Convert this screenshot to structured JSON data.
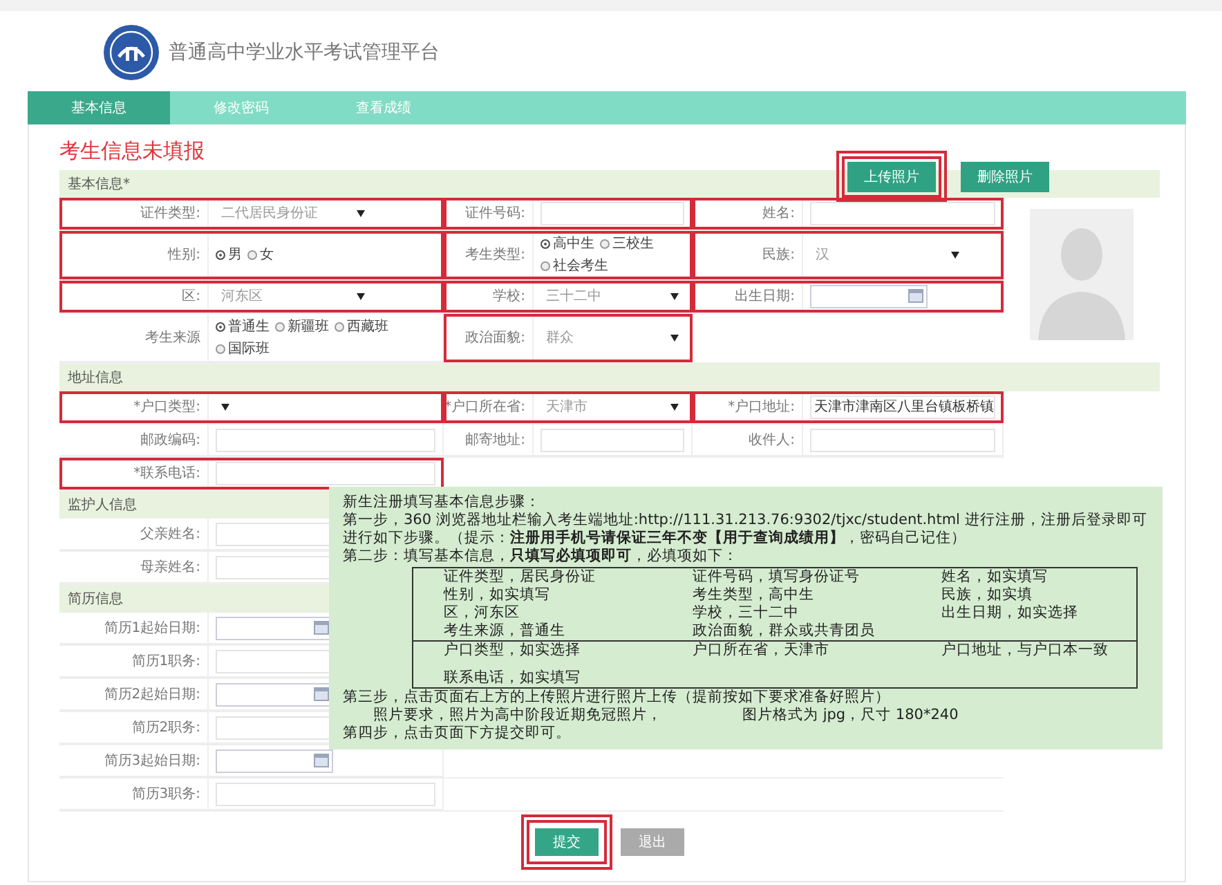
{
  "header": {
    "title": "普通高中学业水平考试管理平台"
  },
  "tabs": [
    {
      "label": "基本信息",
      "selected": true
    },
    {
      "label": "修改密码",
      "selected": false
    },
    {
      "label": "查看成绩",
      "selected": false
    }
  ],
  "form": {
    "title": "考生信息未填报",
    "sections": [
      {
        "title": "基本信息*",
        "buttons": [
          {
            "label": "上传照片",
            "highlighted": true
          },
          {
            "label": "删除照片",
            "highlighted": false
          }
        ],
        "rows": [
          {
            "fields": [
              {
                "label": "证件类型:",
                "kind": "select",
                "value": "二代居民身份证",
                "highlighted": true
              },
              {
                "label": "证件号码:",
                "kind": "input",
                "highlighted": true
              },
              {
                "label": "姓名:",
                "kind": "input",
                "highlighted": true
              }
            ]
          },
          {
            "fields": [
              {
                "label": "性别:",
                "kind": "radio",
                "highlighted": true,
                "options": [
                  {
                    "label": "男",
                    "selected": true
                  },
                  {
                    "label": "女",
                    "selected": false
                  }
                ]
              },
              {
                "label": "考生类型:",
                "kind": "radio",
                "highlighted": true,
                "options": [
                  {
                    "label": "高中生",
                    "selected": true
                  },
                  {
                    "label": "三校生",
                    "selected": false
                  },
                  {
                    "label": "社会考生",
                    "selected": false
                  }
                ]
              },
              {
                "label": "民族:",
                "kind": "select",
                "value": "汉",
                "highlighted": true
              }
            ]
          },
          {
            "fields": [
              {
                "label": "区:",
                "kind": "select",
                "value": "河东区",
                "highlighted": true
              },
              {
                "label": "学校:",
                "kind": "select",
                "value": "三十二中",
                "highlighted": true
              },
              {
                "label": "出生日期:",
                "kind": "date",
                "highlighted": true
              }
            ]
          },
          {
            "fields": [
              {
                "label": "考生来源",
                "kind": "radio",
                "highlighted": false,
                "options": [
                  {
                    "label": "普通生",
                    "selected": true
                  },
                  {
                    "label": "新疆班",
                    "selected": false
                  },
                  {
                    "label": "西藏班",
                    "selected": false
                  },
                  {
                    "label": "国际班",
                    "selected": false
                  }
                ]
              },
              {
                "label": "政治面貌:",
                "kind": "select",
                "value": "群众",
                "highlighted": true
              }
            ]
          }
        ]
      },
      {
        "title": "地址信息",
        "rows": [
          {
            "fields": [
              {
                "label": "*户口类型:",
                "kind": "select",
                "highlighted": true
              },
              {
                "label": "*户口所在省:",
                "kind": "select",
                "value": "天津市",
                "highlighted": true
              },
              {
                "label": "*户口地址:",
                "kind": "input",
                "value": "天津市津南区八里台镇板桥镇",
                "highlighted": true
              }
            ]
          },
          {
            "fields": [
              {
                "label": "邮政编码:",
                "kind": "input",
                "highlighted": false
              },
              {
                "label": "邮寄地址:",
                "kind": "input",
                "highlighted": false
              },
              {
                "label": "收件人:",
                "kind": "input",
                "highlighted": false
              }
            ]
          },
          {
            "fields": [
              {
                "label": "*联系电话:",
                "kind": "input",
                "highlighted": true
              }
            ]
          }
        ]
      },
      {
        "title": "监护人信息",
        "rows": [
          {
            "fields": [
              {
                "label": "父亲姓名:",
                "kind": "input",
                "highlighted": false
              }
            ]
          },
          {
            "fields": [
              {
                "label": "母亲姓名:",
                "kind": "input",
                "highlighted": false
              }
            ]
          }
        ]
      },
      {
        "title": "简历信息",
        "rows": [
          {
            "fields": [
              {
                "label": "简历1起始日期:",
                "kind": "date",
                "highlighted": false
              }
            ]
          },
          {
            "fields": [
              {
                "label": "简历1职务:",
                "kind": "input",
                "highlighted": false
              }
            ]
          },
          {
            "fields": [
              {
                "label": "简历2起始日期:",
                "kind": "date",
                "highlighted": false
              }
            ]
          },
          {
            "fields": [
              {
                "label": "简历2职务:",
                "kind": "input",
                "highlighted": false
              }
            ]
          },
          {
            "fields": [
              {
                "label": "简历3起始日期:",
                "kind": "date",
                "highlighted": false
              }
            ]
          },
          {
            "fields": [
              {
                "label": "简历3职务:",
                "kind": "input",
                "highlighted": false
              }
            ]
          }
        ]
      }
    ],
    "actions": [
      {
        "label": "提交",
        "kind": "primary",
        "highlighted": true
      },
      {
        "label": "退出",
        "kind": "secondary",
        "highlighted": false
      }
    ]
  },
  "guide": {
    "title": "新生注册填写基本信息步骤：",
    "steps": [
      {
        "text": "第一步，360 浏览器地址栏输入考生端地址:http://111.31.213.76:9302/tjxc/student.html 进行注册，注册后登录即可进行如下步骤。（提示：**注册用手机号请保证三年不变【用于查询成绩用】**，密码自己记住）"
      },
      {
        "text": "第二步：填写基本信息，**只填写必填项即可**，必填项如下：",
        "table": [
          [
            [
              "证件类型，居民身份证",
              "证件号码，填写身份证号",
              "姓名，如实填写"
            ],
            [
              "性别，如实填写",
              "考生类型，高中生",
              "民族，如实填"
            ],
            [
              "区，河东区",
              "学校，三十二中",
              "出生日期，如实选择"
            ],
            [
              "考生来源，普通生",
              "政治面貌，群众或共青团员"
            ]
          ],
          [
            [
              "户口类型，如实选择",
              "户口所在省，天津市",
              "户口地址，与户口本一致"
            ],
            [
              "联系电话，如实填写"
            ]
          ]
        ]
      },
      {
        "text": "第三步，点击页面右上方的上传照片进行照片上传（提前按如下要求准备好照片）",
        "notes": [
          "照片要求，照片为高中阶段近期免冠照片，",
          "图片格式为 jpg，尺寸 180*240"
        ]
      },
      {
        "text": "第四步，点击页面下方提交即可。"
      }
    ]
  }
}
